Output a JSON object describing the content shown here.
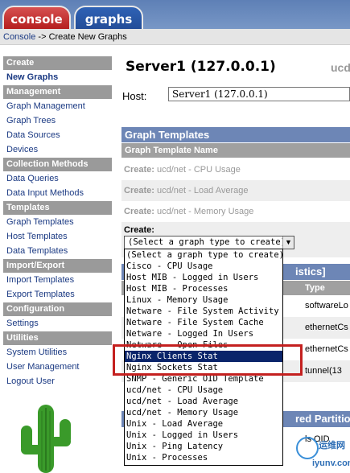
{
  "tabs": [
    {
      "label": "console",
      "color": "#c53333"
    },
    {
      "label": "graphs",
      "color": "#2a58a8"
    }
  ],
  "breadcrumb": {
    "link": "Console",
    "separator": " -> ",
    "current": "Create New Graphs"
  },
  "sidebar": {
    "sections": [
      {
        "header": "Create",
        "items": [
          "New Graphs"
        ]
      },
      {
        "header": "Management",
        "items": [
          "Graph Management",
          "Graph Trees",
          "Data Sources",
          "Devices"
        ]
      },
      {
        "header": "Collection Methods",
        "items": [
          "Data Queries",
          "Data Input Methods"
        ]
      },
      {
        "header": "Templates",
        "items": [
          "Graph Templates",
          "Host Templates",
          "Data Templates"
        ]
      },
      {
        "header": "Import/Export",
        "items": [
          "Import Templates",
          "Export Templates"
        ]
      },
      {
        "header": "Configuration",
        "items": [
          "Settings"
        ]
      },
      {
        "header": "Utilities",
        "items": [
          "System Utilities",
          "User Management",
          "Logout User"
        ]
      }
    ],
    "selected": "New Graphs"
  },
  "main": {
    "title": "Server1 (127.0.0.1)",
    "title_clipped": "ucd",
    "host_label": "Host:",
    "host_value": "Server1 (127.0.0.1)",
    "graph_templates": {
      "header": "Graph Templates",
      "col_header": "Graph Template Name",
      "rows": [
        {
          "prefix": "Create:",
          "name": "ucd/net - CPU Usage"
        },
        {
          "prefix": "Create:",
          "name": "ucd/net - Load Average"
        },
        {
          "prefix": "Create:",
          "name": "ucd/net - Memory Usage"
        }
      ],
      "create_label": "Create:",
      "create_select_value": "(Select a graph type to create)",
      "create_arrow": "▼"
    },
    "background_table": {
      "header_clip": "istics]",
      "type_col": "Type",
      "rows": [
        "softwareLo",
        "ethernetCs",
        "ethernetCs",
        "tunnel(13"
      ],
      "stored_header_clip": "red Partitio",
      "partial_text": "ls OID"
    }
  },
  "dropdown": {
    "options": [
      "(Select a graph type to create)",
      "Cisco - CPU Usage",
      "Host MIB - Logged in Users",
      "Host MIB - Processes",
      "Linux - Memory Usage",
      "Netware - File System Activity",
      "Netware - File System Cache",
      "Netware - Logged In Users",
      "Netware - Open Files",
      "Nginx Clients Stat",
      "Nginx Sockets Stat",
      "SNMP - Generic OID Template",
      "ucd/net - CPU Usage",
      "ucd/net - Load Average",
      "ucd/net - Memory Usage",
      "Unix - Load Average",
      "Unix - Logged in Users",
      "Unix - Ping Latency",
      "Unix - Processes"
    ],
    "highlighted": "Nginx Clients Stat"
  },
  "watermark": {
    "text": "运维网",
    "url": "iyunv.com"
  }
}
